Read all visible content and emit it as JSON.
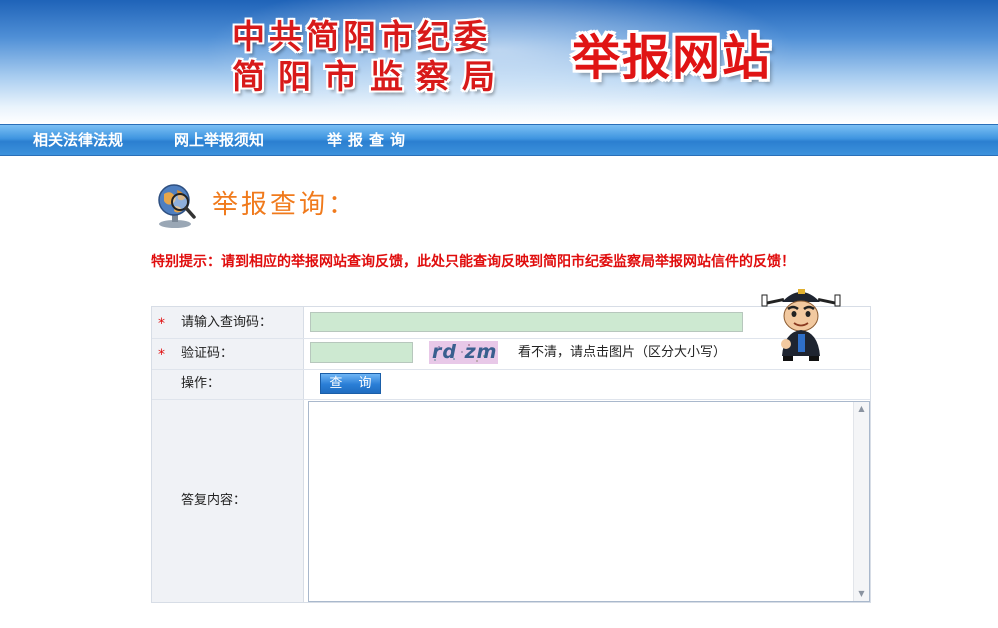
{
  "header": {
    "org_line_1": "中共简阳市纪委",
    "org_line_2": "简阳市监察局",
    "site_title": "举报网站"
  },
  "nav": {
    "items": [
      {
        "label": "相关法律法规"
      },
      {
        "label": "网上举报须知"
      },
      {
        "label": "举报查询"
      }
    ]
  },
  "main": {
    "heading": "举报查询：",
    "notice": "特别提示：请到相应的举报网站查询反馈，此处只能查询反映到简阳市纪委监察局举报网站信件的反馈！"
  },
  "form": {
    "query_code": {
      "required_mark": "*",
      "label": "请输入查询码：",
      "value": ""
    },
    "captcha": {
      "required_mark": "*",
      "label": "验证码：",
      "value": "",
      "image_text": "rd zm",
      "hint": "看不清，请点击图片（区分大小写）"
    },
    "action": {
      "label": "操作：",
      "button_label": "查 询"
    },
    "reply": {
      "label": "答复内容：",
      "value": ""
    }
  },
  "icons": {
    "heading_icon": "globe-magnifier-icon",
    "mascot": "judge-mascot",
    "scroll_up": "scroll-up-icon",
    "scroll_down": "scroll-down-icon"
  },
  "colors": {
    "banner_blue": "#1f63b8",
    "nav_blue": "#3f95e0",
    "title_red": "#e01414",
    "heading_orange": "#f07a1c",
    "notice_red": "#e00d0d",
    "input_green": "#cde9d1",
    "label_bg": "#f0f2f6"
  }
}
